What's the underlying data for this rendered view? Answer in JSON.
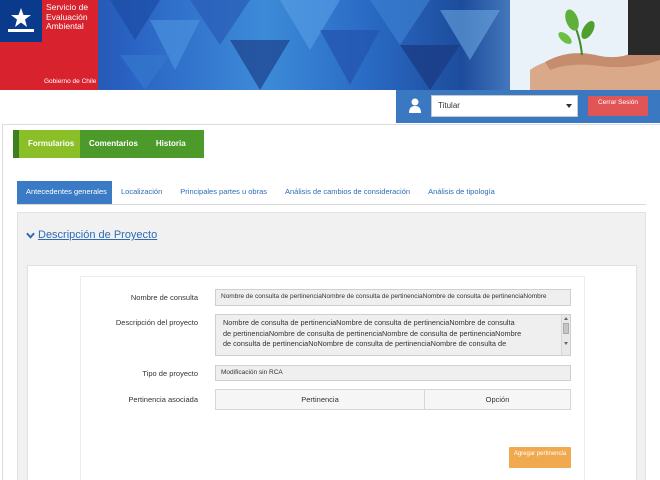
{
  "header": {
    "org_name": "Servicio de Evaluación Ambiental",
    "gov_label": "Gobierno de Chile"
  },
  "userbar": {
    "role_value": "Titular",
    "logout_label": "Cerrar Sesión"
  },
  "nav": {
    "items": [
      "Formularios",
      "Comentarios",
      "Historia"
    ],
    "active": "Formularios"
  },
  "tabs": {
    "items": [
      "Antecedentes generales",
      "Localización",
      "Principales partes u obras",
      "Análisis de cambios de consideración",
      "Análisis de tipología"
    ],
    "active": "Antecedentes generales"
  },
  "section": {
    "title": "Descripción de Proyecto"
  },
  "form": {
    "nombre_label": "Nombre de consulta",
    "nombre_value": "Nombre de consulta de pertinenciaNombre de consulta de pertinenciaNombre de consulta de pertinenciaNombre",
    "descripcion_label": "Descripción del proyecto",
    "descripcion_lines": [
      "Nombre de consulta de pertinenciaNombre de consulta de pertinenciaNombre de consulta",
      "de pertinenciaNombre de consulta de pertinenciaNombre de consulta de pertinenciaNombre",
      "de consulta de pertinenciaNoNombre de consulta de pertinenciaNombre de consulta de"
    ],
    "tipo_label": "Tipo de proyecto",
    "tipo_value": "Modificación sin RCA",
    "pertinencia_label": "Pertinencia asociada",
    "table_columns": [
      "Pertinencia",
      "Opción"
    ],
    "add_label": "Agregar pertinencia"
  },
  "colors": {
    "banner_blue": "#2a63c4",
    "logo_red": "#d8232f",
    "nav_green": "#4c9a2a",
    "nav_active": "#8bbf27",
    "tab_active": "#3b7bc6",
    "logout_red": "#e15556",
    "add_orange": "#f0a94f"
  }
}
